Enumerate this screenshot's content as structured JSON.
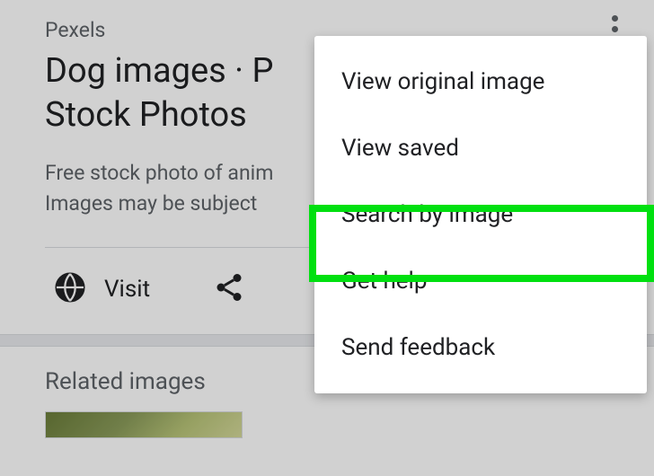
{
  "source": "Pexels",
  "title_line1": "Dog images · P",
  "title_line2": "Stock Photos",
  "desc_line1": "Free stock photo of anim",
  "desc_line2": "Images may be subject",
  "visit_label": "Visit",
  "related_title": "Related images",
  "menu": {
    "items": [
      "View original image",
      "View saved",
      "Search by image",
      "Get help",
      "Send feedback"
    ]
  }
}
